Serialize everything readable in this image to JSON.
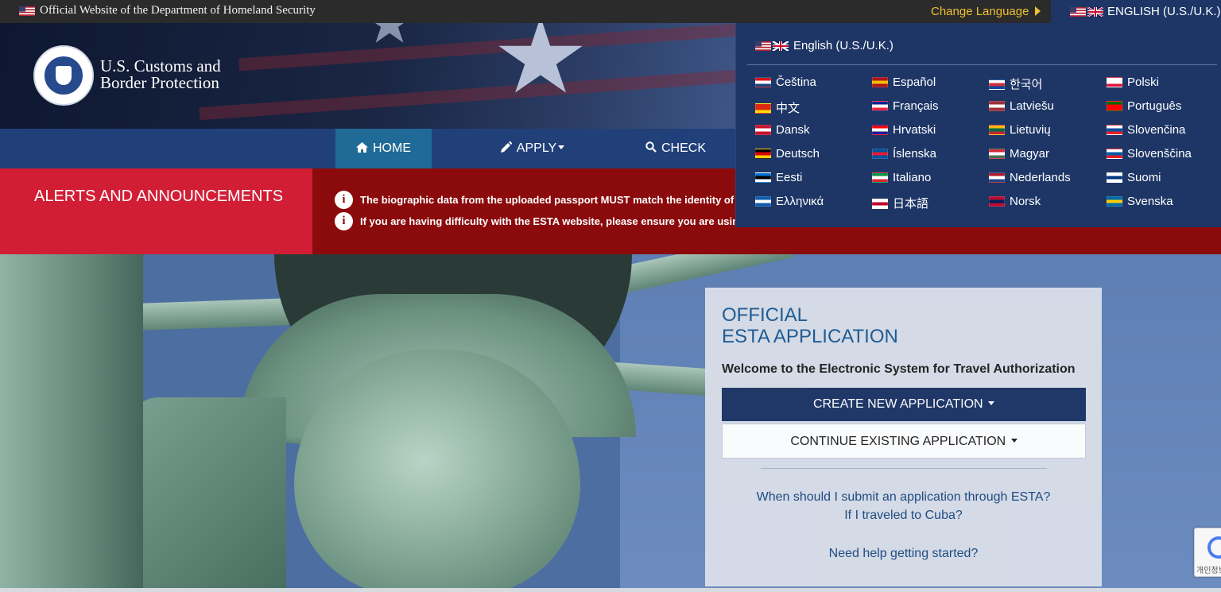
{
  "gov_bar": {
    "official_text": "Official Website of the Department of Homeland Security",
    "change_language": "Change Language",
    "current_language": "ENGLISH (U.S./U.K.)"
  },
  "header": {
    "org_line1": "U.S. Customs and",
    "org_line2": "Border Protection"
  },
  "nav": {
    "home": "HOME",
    "apply": "APPLY",
    "check": "CHECK ESTA"
  },
  "alerts": {
    "label": "ALERTS AND ANNOUNCEMENTS",
    "messages": [
      "The biographic data from the uploaded passport MUST match the identity of the",
      "If you are having difficulty with the ESTA website, please ensure you are using"
    ]
  },
  "panel": {
    "title_line1": "OFFICIAL",
    "title_line2": "ESTA APPLICATION",
    "welcome": "Welcome to the Electronic System for Travel Authorization",
    "create_button": "CREATE NEW APPLICATION",
    "continue_button": "CONTINUE EXISTING APPLICATION",
    "link1": "When should I submit an application through ESTA?",
    "link2": "If I traveled to Cuba?",
    "link3": "Need help getting started?"
  },
  "language_menu": {
    "current": "English (U.S./U.K.)",
    "columns": [
      [
        {
          "label": "Čeština",
          "flag": [
            "#d7141a",
            "#ffffff",
            "#11457e"
          ]
        },
        {
          "label": "中文",
          "flag": [
            "#de2910",
            "#de2910",
            "#ffde00"
          ]
        },
        {
          "label": "Dansk",
          "flag": [
            "#c8102e",
            "#ffffff",
            "#c8102e"
          ]
        },
        {
          "label": "Deutsch",
          "flag": [
            "#000000",
            "#dd0000",
            "#ffce00"
          ]
        },
        {
          "label": "Eesti",
          "flag": [
            "#0072ce",
            "#000000",
            "#ffffff"
          ]
        },
        {
          "label": "Ελληνικά",
          "flag": [
            "#0d5eaf",
            "#ffffff",
            "#0d5eaf"
          ]
        }
      ],
      [
        {
          "label": "Español",
          "flag": [
            "#aa151b",
            "#f1bf00",
            "#aa151b"
          ]
        },
        {
          "label": "Français",
          "flag": [
            "#002395",
            "#ffffff",
            "#ed2939"
          ]
        },
        {
          "label": "Hrvatski",
          "flag": [
            "#ff0000",
            "#ffffff",
            "#171796"
          ]
        },
        {
          "label": "Íslenska",
          "flag": [
            "#02529c",
            "#dc1e35",
            "#02529c"
          ]
        },
        {
          "label": "Italiano",
          "flag": [
            "#009246",
            "#ffffff",
            "#ce2b37"
          ]
        },
        {
          "label": "日本語",
          "flag": [
            "#ffffff",
            "#bc002d",
            "#ffffff"
          ]
        }
      ],
      [
        {
          "label": "한국어",
          "flag": [
            "#ffffff",
            "#cd2e3a",
            "#0047a0"
          ]
        },
        {
          "label": "Latviešu",
          "flag": [
            "#9e3039",
            "#ffffff",
            "#9e3039"
          ]
        },
        {
          "label": "Lietuvių",
          "flag": [
            "#fdb913",
            "#006a44",
            "#c1272d"
          ]
        },
        {
          "label": "Magyar",
          "flag": [
            "#ce2939",
            "#ffffff",
            "#477050"
          ]
        },
        {
          "label": "Nederlands",
          "flag": [
            "#ae1c28",
            "#ffffff",
            "#21468b"
          ]
        },
        {
          "label": "Norsk",
          "flag": [
            "#ba0c2f",
            "#00205b",
            "#ba0c2f"
          ]
        }
      ],
      [
        {
          "label": "Polski",
          "flag": [
            "#ffffff",
            "#ffffff",
            "#dc143c"
          ]
        },
        {
          "label": "Português",
          "flag": [
            "#006600",
            "#ff0000",
            "#ff0000"
          ]
        },
        {
          "label": "Slovenčina",
          "flag": [
            "#ffffff",
            "#0b4ea2",
            "#ee1c25"
          ]
        },
        {
          "label": "Slovenščina",
          "flag": [
            "#ffffff",
            "#005da4",
            "#ed1c24"
          ]
        },
        {
          "label": "Suomi",
          "flag": [
            "#ffffff",
            "#003580",
            "#ffffff"
          ]
        },
        {
          "label": "Svenska",
          "flag": [
            "#006aa7",
            "#fecc00",
            "#006aa7"
          ]
        }
      ]
    ]
  },
  "recaptcha": {
    "text": "개인정보"
  },
  "colors": {
    "nav_bg": "#21407a",
    "home_active": "#1f6a96",
    "alert_label": "#d11e35",
    "alert_bg": "#8b0b0d",
    "primary_button": "#1e3666",
    "accent_gold": "#f0c030"
  }
}
